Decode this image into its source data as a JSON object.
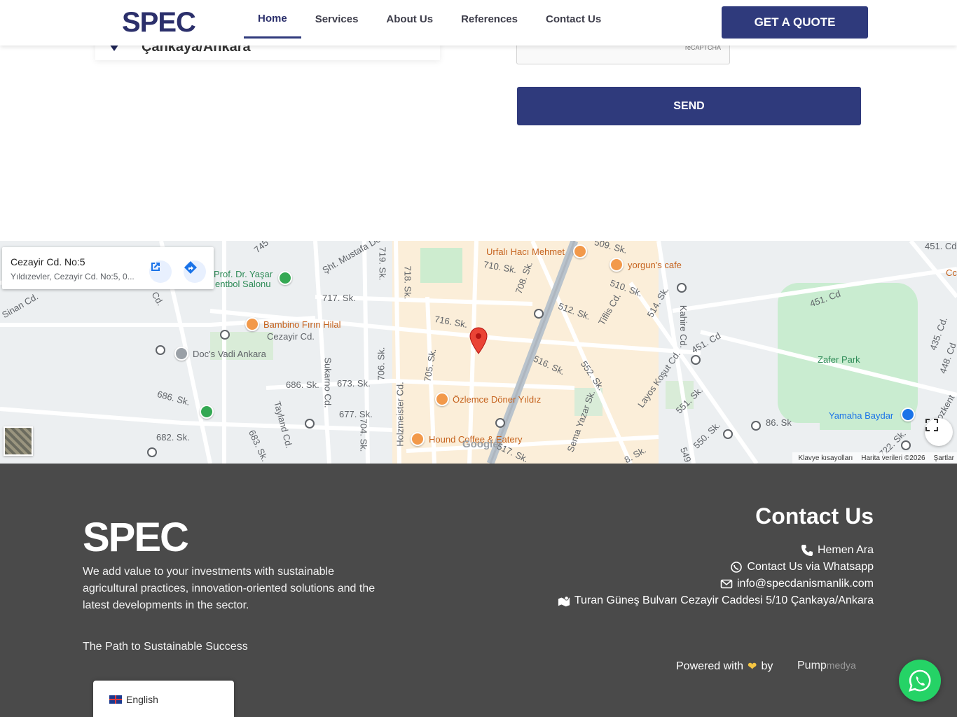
{
  "header": {
    "logo": "SPEC",
    "nav": [
      "Home",
      "Services",
      "About Us",
      "References",
      "Contact Us"
    ],
    "quote_button": "GET A QUOTE"
  },
  "contact_section": {
    "address_partial": "Çankaya/Ankara",
    "captcha_label": "reCAPTCHA",
    "send_button": "SEND"
  },
  "map": {
    "info_title": "Cezayir Cd. No:5",
    "info_subtitle": "Yıldızevler, Cezayir Cd. No:5, 0...",
    "labels": {
      "sht_mustafa": "Şht. Mustafa Do",
      "s745": "745",
      "sinan": "Sinan Cd.",
      "cd_left": "Cd.",
      "prof1": "Prof. Dr. Yaşar",
      "prof2": "entbol Salonu",
      "s717": "717. Sk.",
      "s719": "719. Sk.",
      "s718": "718. Sk.",
      "urfali": "Urfalı Hacı Mehmet",
      "s710": "710. Sk.",
      "s708": "708. Sk.",
      "s509": "509. Sk.",
      "yorgun": "yorgun's cafe",
      "s510": "510. Sk.",
      "s514": "514. Sk.",
      "tiflis": "Tiflis Cd.",
      "s512": "512. Sk.",
      "kahire": "Kahire Cd.",
      "s451a": "451. Cd",
      "s451b": "451. Cd",
      "s451c": "451. Cd",
      "bambino": "Bambino Fırın Hilal",
      "cezayir": "Cezayir Cd.",
      "s716": "716. Sk.",
      "docs": "Doc's Vadi Ankara",
      "s686a": "686. Sk.",
      "s686b": "686. Sk.",
      "sukarno": "Sukarno Cd.",
      "s673": "673. Sk.",
      "s706": "706. Sk.",
      "s705": "705. Sk.",
      "s516": "516. Sk.",
      "s552": "552. Sk.",
      "lajos": "Layos Koşut Cd.",
      "s551": "551. Sk.",
      "zafer": "Zafer Park",
      "s435": "435. Cd.",
      "s448": "448. Cd",
      "ozlemce": "Özlemce Döner Yıldız",
      "holzmeister": "Holzmeister Cd.",
      "tayland": "Tayland Cd.",
      "s677": "677. Sk.",
      "s704": "704. Sk.",
      "s682": "682. Sk.",
      "s683": "683. Sk.",
      "sema": "Sema Yazar Sk.",
      "yamaha": "Yamaha Baydar",
      "s86": "86. Sk",
      "s550": "550. Sk.",
      "s549": "549",
      "hound": "Hound Coffee & Eatery",
      "s517": "517. Sk.",
      "s722": "722. Sk.",
      "s8": "8. Sk.",
      "cc": "Cc",
      "s451top": "451. Cd",
      "bozkent": "ozkent"
    },
    "google": "Google",
    "footer": [
      "Klavye kısayolları",
      "Harita verileri ©2026",
      "Şartlar"
    ]
  },
  "footer": {
    "logo": "SPEC",
    "description": "We add value to your investments with sustainable agricultural practices, innovation-oriented solutions and the latest developments in the sector.",
    "tagline": "The Path to Sustainable Success",
    "contact_title": "Contact Us",
    "links": [
      {
        "icon": "phone-icon",
        "text": "Hemen Ara"
      },
      {
        "icon": "whatsapp-icon",
        "text": "Contact Us via Whatsapp"
      },
      {
        "icon": "mail-icon",
        "text": "info@specdanismanlik.com"
      },
      {
        "icon": "map-icon",
        "text": "Turan Güneş Bulvarı Cezayir Caddesi 5/10 Çankaya/Ankara"
      }
    ],
    "powered_prefix": "Powered with",
    "powered_by": "by",
    "pump": "Pump",
    "medya": "medya",
    "language": "English"
  },
  "colors": {
    "brand": "#2f3a7c",
    "footer_bg": "#4a4a4a",
    "whatsapp": "#25d366"
  }
}
